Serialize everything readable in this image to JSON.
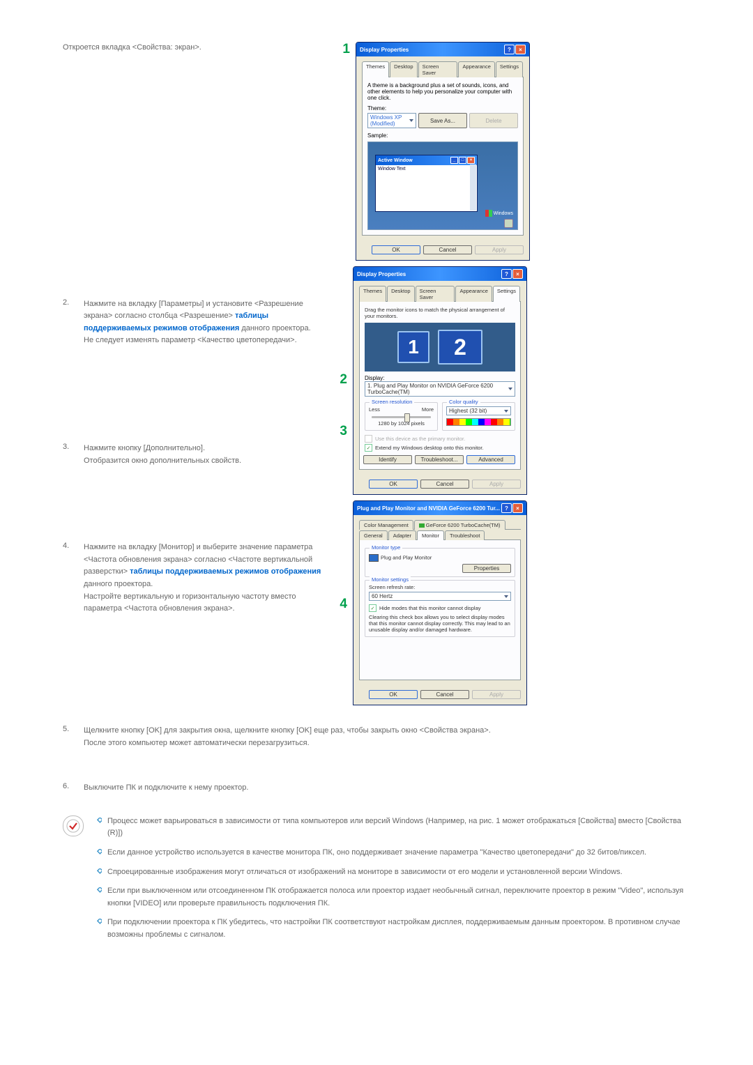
{
  "intro": "Откроется вкладка <Свойства: экран>.",
  "steps": [
    {
      "n": "2.",
      "lines": [
        "Нажмите на вкладку [Параметры] и установите <Разрешение экрана> согласно столбца <Разрешение> ",
        " данного проектора.",
        "Не следует изменять параметр <Качество цветопередачи>."
      ],
      "link": "таблицы поддерживаемых режимов отображения"
    },
    {
      "n": "3.",
      "lines": [
        "Нажмите кнопку [Дополнительно].",
        "Отобразится окно дополнительных свойств."
      ]
    },
    {
      "n": "4.",
      "lines": [
        "Нажмите на вкладку [Монитор] и выберите значение параметра <Частота обновления экрана> согласно <Частоте вертикальной разверстки> ",
        " данного проектора.",
        "Настройте вертикальную и горизонтальную частоту вместо параметра <Частота обновления экрана>."
      ],
      "link": "таблицы поддерживаемых режимов отображения"
    },
    {
      "n": "5.",
      "lines": [
        "Щелкните кнопку [OK] для закрытия окна, щелкните кнопку [OK] еще раз, чтобы закрыть окно <Свойства экрана>.",
        "После этого компьютер может автоматически перезагрузиться."
      ]
    },
    {
      "n": "6.",
      "lines": [
        "Выключите ПК и подключите к нему проектор."
      ]
    }
  ],
  "call": {
    "c1": "1",
    "c2": "2",
    "c3": "3",
    "c4": "4"
  },
  "dlg1": {
    "title": "Display Properties",
    "tabs": [
      "Themes",
      "Desktop",
      "Screen Saver",
      "Appearance",
      "Settings"
    ],
    "desc": "A theme is a background plus a set of sounds, icons, and other elements to help you personalize your computer with one click.",
    "theme_lbl": "Theme:",
    "theme_val": "Windows XP (Modified)",
    "saveas": "Save As...",
    "delete": "Delete",
    "sample_lbl": "Sample:",
    "aw": "Active Window",
    "wt": "Window Text",
    "brand": "Windows",
    "ok": "OK",
    "cancel": "Cancel",
    "apply": "Apply"
  },
  "dlg2": {
    "title": "Display Properties",
    "tabs": [
      "Themes",
      "Desktop",
      "Screen Saver",
      "Appearance",
      "Settings"
    ],
    "instr": "Drag the monitor icons to match the physical arrangement of your monitors.",
    "m1": "1",
    "m2": "2",
    "disp_lbl": "Display:",
    "disp_val": "1. Plug and Play Monitor on NVIDIA GeForce 6200 TurboCache(TM)",
    "sr": "Screen resolution",
    "less": "Less",
    "more": "More",
    "res": "1280 by 1024 pixels",
    "cq": "Color quality",
    "cq_val": "Highest (32 bit)",
    "ck1": "Use this device as the primary monitor.",
    "ck2": "Extend my Windows desktop onto this monitor.",
    "identify": "Identify",
    "trouble": "Troubleshoot...",
    "adv": "Advanced",
    "ok": "OK",
    "cancel": "Cancel",
    "apply": "Apply"
  },
  "dlg3": {
    "title": "Plug and Play Monitor and NVIDIA GeForce 6200 Tur...",
    "tabs_top": [
      "Color Management",
      "GeForce 6200 TurboCache(TM)"
    ],
    "tabs_bot": [
      "General",
      "Adapter",
      "Monitor",
      "Troubleshoot"
    ],
    "mt": "Monitor type",
    "mt_val": "Plug and Play Monitor",
    "props": "Properties",
    "ms": "Monitor settings",
    "rr_lbl": "Screen refresh rate:",
    "rr_val": "60 Hertz",
    "hide": "Hide modes that this monitor cannot display",
    "warn": "Clearing this check box allows you to select display modes that this monitor cannot display correctly. This may lead to an unusable display and/or damaged hardware.",
    "ok": "OK",
    "cancel": "Cancel",
    "apply": "Apply"
  },
  "notes": [
    "Процесс может варьироваться в зависимости от типа компьютеров или версий Windows (Например, на рис. 1 может отображаться [Свойства] вместо [Свойства (R)])",
    "Если данное устройство используется в качестве монитора ПК, оно поддерживает значение параметра \"Качество цветопередачи\" до 32 битов/пиксел.",
    "Спроецированные изображения могут отличаться от изображений на мониторе в зависимости от его модели и установленной версии Windows.",
    "Если при выключенном или отсоединенном ПК отображается полоса или проектор издает необычный сигнал, переключите проектор в режим \"Video\", используя кнопки [VIDEO] или проверьте правильность подключения ПК.",
    "При подключении проектора к ПК убедитесь, что настройки ПК соответствуют настройкам дисплея, поддерживаемым данным проектором. В противном случае возможны проблемы с сигналом."
  ]
}
